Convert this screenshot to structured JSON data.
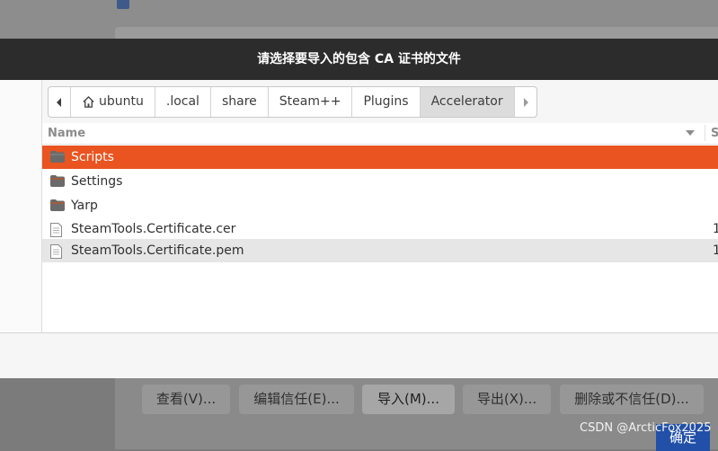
{
  "dialog": {
    "title": "请选择要导入的包含 CA 证书的文件"
  },
  "pathbar": {
    "back_icon": "chevron-left-icon",
    "forward_icon": "chevron-right-icon",
    "home_icon": "home-icon",
    "crumbs": [
      "ubuntu",
      ".local",
      "share",
      "Steam++",
      "Plugins",
      "Accelerator"
    ],
    "active_index": 5
  },
  "filelist": {
    "columns": {
      "name": "Name",
      "size": "S"
    },
    "rows": [
      {
        "name": "Scripts",
        "type": "folder",
        "size": "",
        "state": "selected"
      },
      {
        "name": "Settings",
        "type": "folder",
        "size": "",
        "state": "normal"
      },
      {
        "name": "Yarp",
        "type": "folder",
        "size": "",
        "state": "normal"
      },
      {
        "name": "SteamTools.Certificate.cer",
        "type": "file",
        "size": "1",
        "state": "normal"
      },
      {
        "name": "SteamTools.Certificate.pem",
        "type": "file",
        "size": "1",
        "state": "hover"
      }
    ]
  },
  "background": {
    "buttons": {
      "view": "查看(V)...",
      "edit_trust": "编辑信任(E)...",
      "import": "导入(M)...",
      "export": "导出(X)...",
      "delete": "删除或不信任(D)..."
    },
    "ok": "确定",
    "watermark": "CSDN @ArcticFox2025"
  },
  "colors": {
    "accent": "#e95420",
    "titlebar": "#2c2c2c"
  }
}
